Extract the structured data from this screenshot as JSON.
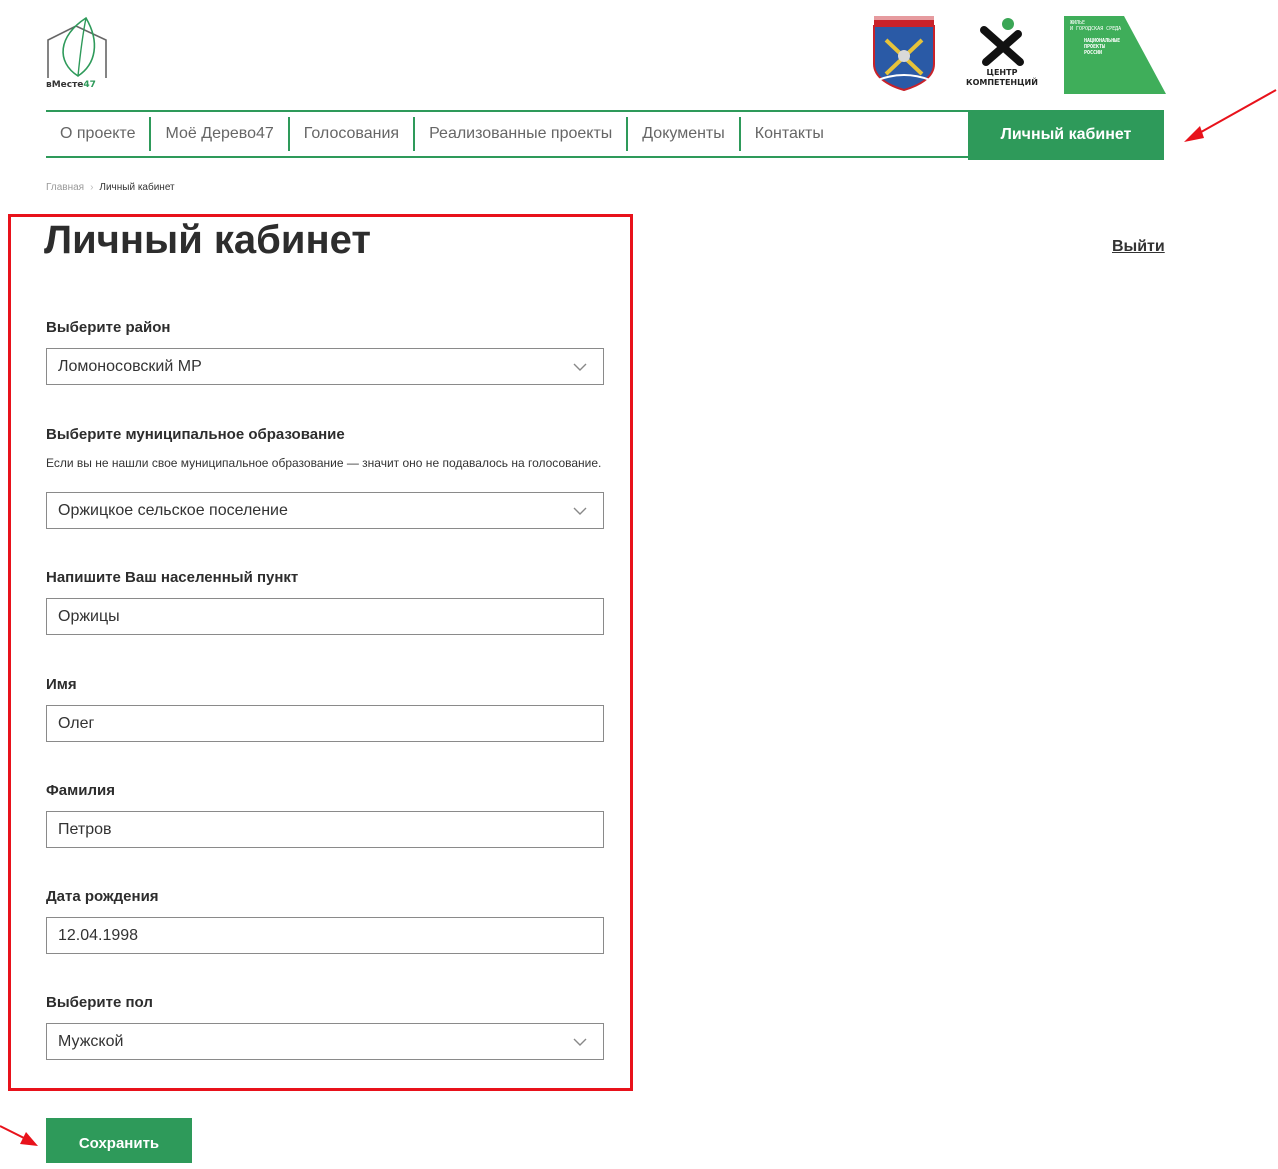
{
  "header": {
    "logo": {
      "name": "вМесте",
      "accent": "47"
    },
    "centr_label_line1": "ЦЕНТР",
    "centr_label_line2": "КОМПЕТЕНЦИЙ",
    "natproj_small1": "ЖИЛЬЕ",
    "natproj_small2": "И ГОРОДСКАЯ СРЕДА",
    "natproj_line1": "НАЦИОНАЛЬНЫЕ",
    "natproj_line2": "ПРОЕКТЫ",
    "natproj_line3": "РОССИИ"
  },
  "nav": {
    "items": [
      "О проекте",
      "Моё Дерево47",
      "Голосования",
      "Реализованные проекты",
      "Документы",
      "Контакты"
    ],
    "cabinet": "Личный кабинет"
  },
  "breadcrumb": {
    "home": "Главная",
    "sep": "›",
    "current": "Личный кабинет"
  },
  "page": {
    "title": "Личный кабинет",
    "logout": "Выйти"
  },
  "form": {
    "district": {
      "label": "Выберите район",
      "value": "Ломоносовский МР"
    },
    "municipality": {
      "label": "Выберите муниципальное образование",
      "hint": "Если вы не нашли свое муниципальное образование — значит оно не подавалось на голосование.",
      "value": "Оржицкое сельское поселение"
    },
    "settlement": {
      "label": "Напишите Ваш населенный пункт",
      "value": "Оржицы"
    },
    "first_name": {
      "label": "Имя",
      "value": "Олег"
    },
    "last_name": {
      "label": "Фамилия",
      "value": "Петров"
    },
    "birth_date": {
      "label": "Дата рождения",
      "value": "12.04.1998"
    },
    "gender": {
      "label": "Выберите пол",
      "value": "Мужской"
    },
    "save": "Сохранить"
  },
  "colors": {
    "brand_green": "#2e9a5a",
    "annotation_red": "#e8121b"
  }
}
